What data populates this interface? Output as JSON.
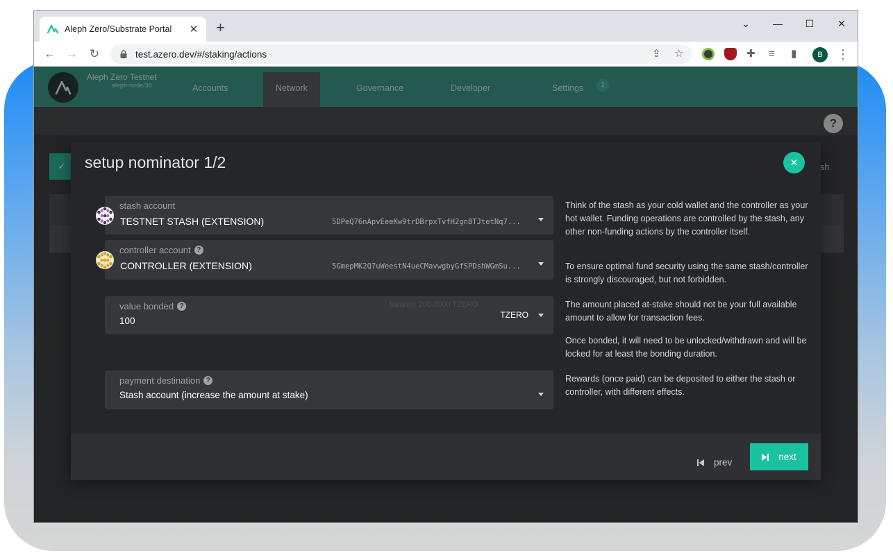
{
  "browser": {
    "tab_title": "Aleph Zero/Substrate Portal",
    "url": "test.azero.dev/#/staking/actions",
    "profile_initial": "B"
  },
  "app": {
    "chain_name": "Aleph Zero Testnet",
    "node_name": "aleph-node/38",
    "menu": {
      "accounts": "Accounts",
      "network": "Network",
      "governance": "Governance",
      "developer": "Developer",
      "settings": "Settings",
      "settings_badge": "1"
    },
    "background_text_partial": "sh"
  },
  "modal": {
    "title": "setup nominator 1/2",
    "stash": {
      "label": "stash account",
      "value": "TESTNET STASH (EXTENSION)",
      "address": "5DPeQ76nApvEeeKw9trDBrpxTvfH2gn8TJtetNq7..."
    },
    "controller": {
      "label": "controller account",
      "value": "CONTROLLER (EXTENSION)",
      "address": "5GmepMK2Q7uWeestN4ueCMavwgbyGfSPDshWGmSu..."
    },
    "bonded": {
      "label": "value bonded",
      "value": "100",
      "balance": "balance  200.0000 TZERO",
      "unit": "TZERO"
    },
    "payment": {
      "label": "payment destination",
      "value": "Stash account (increase the amount at stake)"
    },
    "help": {
      "stash": "Think of the stash as your cold wallet and the controller as your hot wallet. Funding operations are controlled by the stash, any other non-funding actions by the controller itself.",
      "security": "To ensure optimal fund security using the same stash/controller is strongly discouraged, but not forbidden.",
      "amount": "The amount placed at-stake should not be your full available amount to allow for transaction fees.",
      "unlock": "Once bonded, it will need to be unlocked/withdrawn and will be locked for at least the bonding duration.",
      "rewards": "Rewards (once paid) can be deposited to either the stash or controller, with different effects."
    },
    "prev_label": "prev",
    "next_label": "next"
  },
  "colors": {
    "accent": "#19c39f",
    "header": "#2f8a78"
  }
}
